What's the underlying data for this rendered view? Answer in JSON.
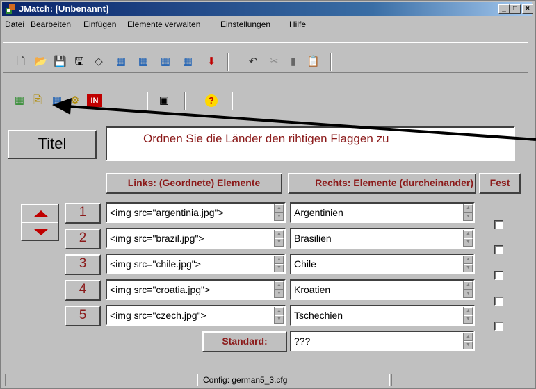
{
  "window": {
    "title": "JMatch: [Unbenannt]",
    "controls": [
      "_",
      "□",
      "X"
    ]
  },
  "menu": [
    "Datei",
    "Bearbeiten",
    "Einfügen",
    "Elemente verwalten",
    "Einstellungen",
    "Hilfe"
  ],
  "toolbar1": {
    "icons": [
      "new-file-icon",
      "open-folder-icon",
      "save-icon",
      "save-as-icon",
      "eraser-icon",
      "export-web-1-icon",
      "export-web-2-icon",
      "export-web-3-icon",
      "export-web-4-icon",
      "down-arrow-icon",
      "undo-icon",
      "cut-icon",
      "copy-icon",
      "paste-icon"
    ],
    "glyphs": [
      "🗋",
      "📂",
      "💾",
      "🖫",
      "◇",
      "▦",
      "▦",
      "▦",
      "▦",
      "⬇",
      "↶",
      "✂",
      "▮",
      "📋"
    ]
  },
  "toolbar2": {
    "icons": [
      "web-page-icon",
      "load-image-icon",
      "cancel-web-icon",
      "settings-icon",
      "in-icon",
      "config-icon",
      "help-icon"
    ],
    "glyphs": [
      "▦",
      "🖻",
      "▦",
      "⚙",
      "IN",
      "▣",
      "?"
    ]
  },
  "titel": {
    "button_label": "Titel",
    "value": "Ordnen Sie die Länder den rihtigen Flaggen zu"
  },
  "columns": {
    "left": "Links: (Geordnete) Elemente",
    "right": "Rechts: Elemente (durcheinander)",
    "fixed": "Fest"
  },
  "rows": [
    {
      "num": "1",
      "left": "<img src=\"argentinia.jpg\">",
      "right": "Argentinien",
      "fixed": false
    },
    {
      "num": "2",
      "left": "<img src=\"brazil.jpg\">",
      "right": "Brasilien",
      "fixed": false
    },
    {
      "num": "3",
      "left": "<img src=\"chile.jpg\">",
      "right": "Chile",
      "fixed": false
    },
    {
      "num": "4",
      "left": "<img src=\"croatia.jpg\">",
      "right": "Kroatien",
      "fixed": false
    },
    {
      "num": "5",
      "left": "<img src=\"czech.jpg\">",
      "right": "Tschechien",
      "fixed": false
    }
  ],
  "standard": {
    "label": "Standard:",
    "value": "???"
  },
  "status": {
    "config": "Config: german5_3.cfg"
  },
  "colors": {
    "accent": "#8b1a1a",
    "arrow": "#c00000"
  }
}
